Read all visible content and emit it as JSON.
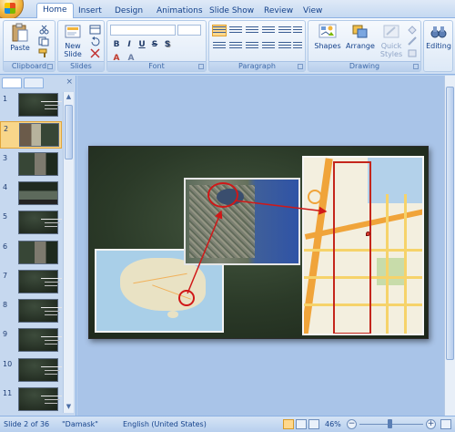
{
  "ribbon_tabs": [
    {
      "label": "Home",
      "active": true
    },
    {
      "label": "Insert",
      "active": false
    },
    {
      "label": "Design",
      "active": false
    },
    {
      "label": "Animations",
      "active": false
    },
    {
      "label": "Slide Show",
      "active": false
    },
    {
      "label": "Review",
      "active": false
    },
    {
      "label": "View",
      "active": false
    }
  ],
  "ribbon": {
    "clipboard": {
      "paste_label": "Paste",
      "group_label": "Clipboard"
    },
    "slides": {
      "new_slide_label": "New Slide",
      "group_label": "Slides"
    },
    "font": {
      "group_label": "Font",
      "bold": "B",
      "italic": "I",
      "underline": "U",
      "strike": "S",
      "shadow": "S",
      "font_color": "A",
      "clear": "A"
    },
    "paragraph": {
      "group_label": "Paragraph"
    },
    "drawing": {
      "shapes_label": "Shapes",
      "arrange_label": "Arrange",
      "quick_styles_label": "Quick Styles",
      "group_label": "Drawing"
    },
    "editing": {
      "editing_label": "Editing"
    }
  },
  "slide_pane": {
    "close_glyph": "×",
    "slides": [
      {
        "number": "1",
        "style": "text",
        "selected": false
      },
      {
        "number": "2",
        "style": "photo",
        "selected": true
      },
      {
        "number": "3",
        "style": "photo2",
        "selected": false
      },
      {
        "number": "4",
        "style": "photo3",
        "selected": false
      },
      {
        "number": "5",
        "style": "text",
        "selected": false
      },
      {
        "number": "6",
        "style": "photo2",
        "selected": false
      },
      {
        "number": "7",
        "style": "text",
        "selected": false
      },
      {
        "number": "8",
        "style": "text",
        "selected": false
      },
      {
        "number": "9",
        "style": "text",
        "selected": false
      },
      {
        "number": "10",
        "style": "text",
        "selected": false
      },
      {
        "number": "11",
        "style": "text",
        "selected": false
      }
    ]
  },
  "status_bar": {
    "slide_info": "Slide 2 of 36",
    "theme": "\"Damask\"",
    "language": "English (United States)",
    "zoom": "46%",
    "zoom_minus": "−",
    "zoom_plus": "+"
  },
  "colors": {
    "accent_ribbon": "#dbe7f6",
    "selection": "#f8d68a",
    "highlight_circle": "#d01818"
  }
}
